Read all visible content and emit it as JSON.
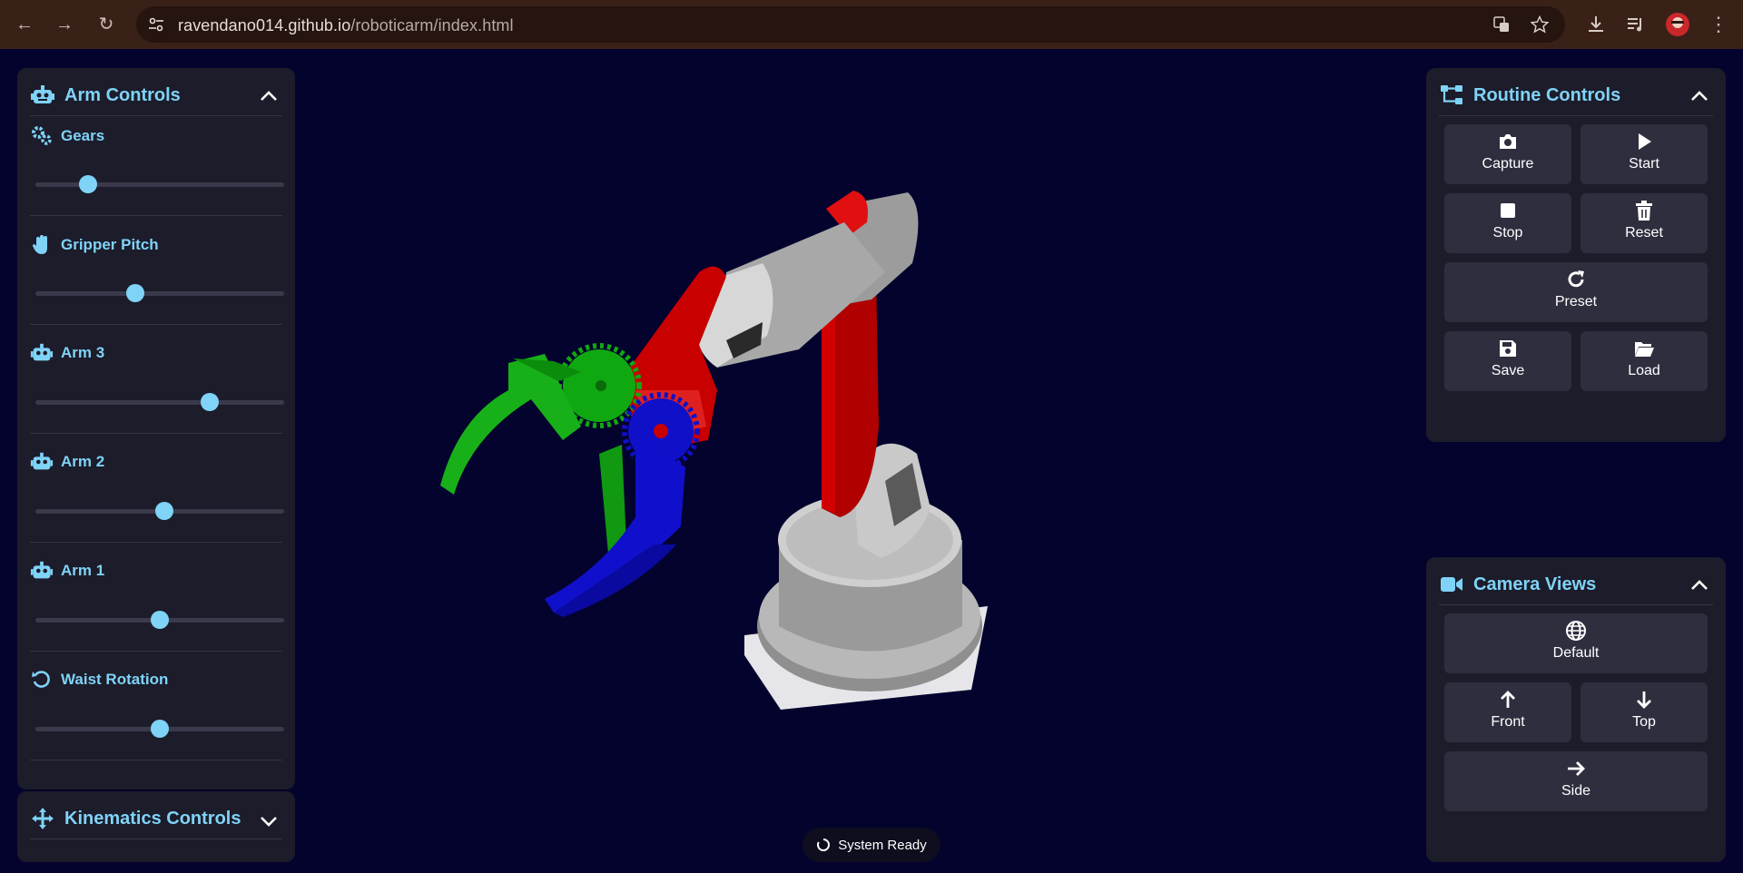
{
  "browser": {
    "url_host": "ravendano014.github.io",
    "url_path": "/roboticarm/index.html"
  },
  "arm_controls": {
    "title": "Arm Controls",
    "sliders": [
      {
        "label": "Gears",
        "icon": "gears-icon",
        "value": 0.21
      },
      {
        "label": "Gripper Pitch",
        "icon": "hand-icon",
        "value": 0.4
      },
      {
        "label": "Arm 3",
        "icon": "robot-icon",
        "value": 0.7
      },
      {
        "label": "Arm 2",
        "icon": "robot-icon",
        "value": 0.52
      },
      {
        "label": "Arm 1",
        "icon": "robot-icon",
        "value": 0.5
      },
      {
        "label": "Waist Rotation",
        "icon": "rotate-icon",
        "value": 0.5
      }
    ]
  },
  "kinematics_controls": {
    "title": "Kinematics Controls"
  },
  "routine_controls": {
    "title": "Routine Controls",
    "buttons": {
      "capture": "Capture",
      "start": "Start",
      "stop": "Stop",
      "reset": "Reset",
      "preset": "Preset",
      "save": "Save",
      "load": "Load"
    }
  },
  "camera_views": {
    "title": "Camera Views",
    "buttons": {
      "default": "Default",
      "front": "Front",
      "top": "Top",
      "side": "Side"
    }
  },
  "status": {
    "text": "System Ready"
  },
  "colors": {
    "accent": "#7fd3f7",
    "background": "#03032e",
    "panel": "#1c1c2a",
    "button": "#2e2e3f"
  }
}
